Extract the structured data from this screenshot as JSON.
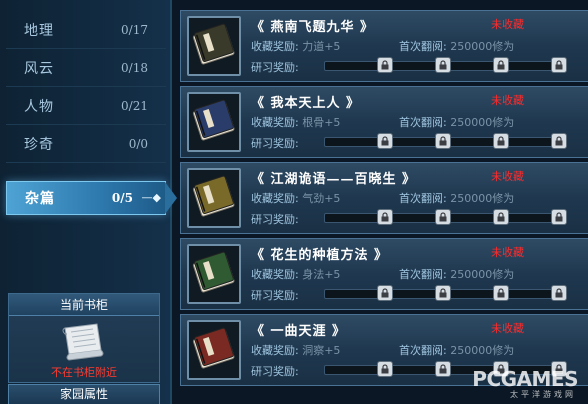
{
  "sidebar": {
    "categories": [
      {
        "name": "地理",
        "count": "0/17"
      },
      {
        "name": "风云",
        "count": "0/18"
      },
      {
        "name": "人物",
        "count": "0/21"
      },
      {
        "name": "珍奇",
        "count": "0/0"
      },
      {
        "name": "杂篇",
        "count": "0/5",
        "active": true
      }
    ],
    "active_arrow": "—◆",
    "shelf": {
      "title": "当前书柜",
      "status": "不在书柜附近",
      "icon": "scroll-icon"
    },
    "home_attr": "家园属性"
  },
  "labels": {
    "collect_reward": "收藏奖励:",
    "first_read": "首次翻阅:",
    "research_reward": "研习奖励:"
  },
  "books": [
    {
      "title": "《 燕南飞题九华 》",
      "status": "未收藏",
      "reward": "力道+5",
      "first_read": "250000修为",
      "cover": "#3a3a2a"
    },
    {
      "title": "《 我本天上人 》",
      "status": "未收藏",
      "reward": "根骨+5",
      "first_read": "250000修为",
      "cover": "#2a3d6a"
    },
    {
      "title": "《 江湖诡语——百晓生 》",
      "status": "未收藏",
      "reward": "气劲+5",
      "first_read": "250000修为",
      "cover": "#7a6a2a"
    },
    {
      "title": "《 花生的种植方法 》",
      "status": "未收藏",
      "reward": "身法+5",
      "first_read": "250000修为",
      "cover": "#2f5a32"
    },
    {
      "title": "《 一曲天涯 》",
      "status": "未收藏",
      "reward": "洞察+5",
      "first_read": "250000修为",
      "cover": "#7a2a22"
    }
  ],
  "lock_icon": "lock-icon",
  "watermark": {
    "big": "PCGAMES",
    "small": "太平洋游戏网"
  }
}
